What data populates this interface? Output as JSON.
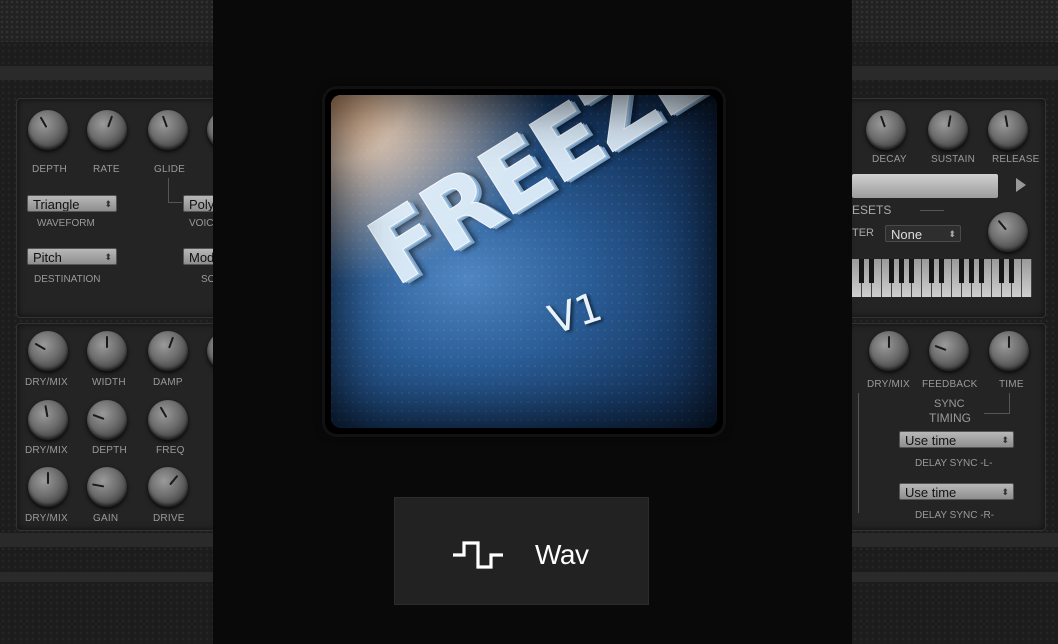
{
  "left_panel": {
    "lfo": {
      "knobs": [
        "DEPTH",
        "RATE",
        "GLIDE"
      ],
      "waveform_select": "Triangle",
      "waveform_label": "WAVEFORM",
      "voice_select": "Poly",
      "voice_label": "VOIC",
      "destination_select": "Pitch",
      "destination_label": "DESTINATION",
      "source_select": "Mod",
      "source_label": "SO"
    },
    "fx": {
      "row1": [
        "DRY/MIX",
        "WIDTH",
        "DAMP"
      ],
      "row2": [
        "DRY/MIX",
        "DEPTH",
        "FREQ"
      ],
      "row3": [
        "DRY/MIX",
        "GAIN",
        "DRIVE"
      ]
    }
  },
  "right_panel": {
    "env_knobs": [
      "DECAY",
      "SUSTAIN",
      "RELEASE"
    ],
    "presets_label": "ESETS",
    "filter_label": "TER",
    "filter_select": "None",
    "delay_knobs": [
      "DRY/MIX",
      "FEEDBACK",
      "TIME"
    ],
    "sync_label": "SYNC",
    "timing_label": "TIMING",
    "delay_l_select": "Use time",
    "delay_l_label": "DELAY SYNC -L-",
    "delay_r_select": "Use time",
    "delay_r_label": "DELAY SYNC -R-"
  },
  "artwork": {
    "title": "FREEZE",
    "version": "V1"
  },
  "format_button": {
    "icon": "square-wave-icon",
    "label": "Wav"
  }
}
